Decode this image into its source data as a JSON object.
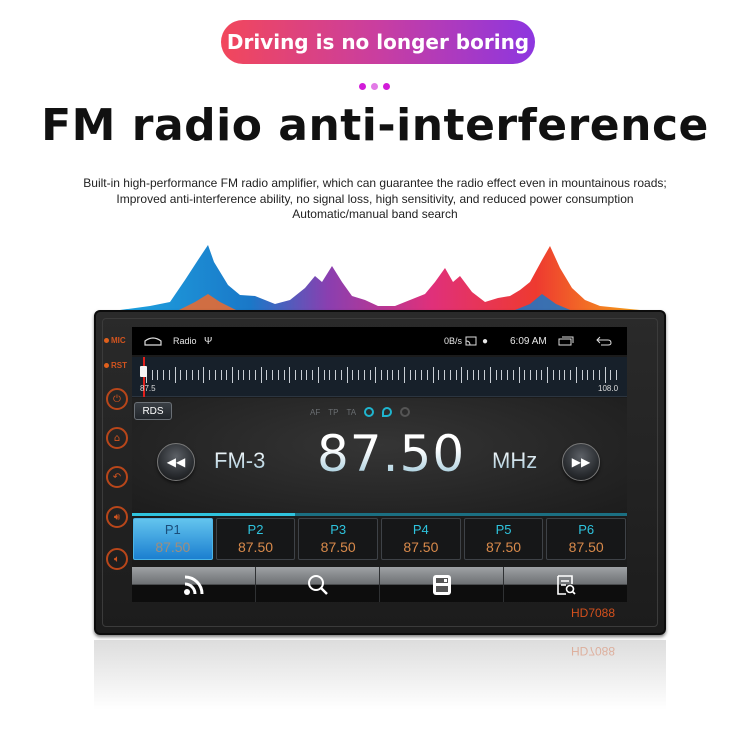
{
  "promo": {
    "banner": "Driving is no longer boring",
    "banner_colors": [
      "#f2475b",
      "#8d36e0"
    ],
    "dot_colors": [
      "#d21cd9",
      "#e27ae6",
      "#d21cd9"
    ],
    "headline": "FM radio anti-interference",
    "description": [
      "Built-in high-performance FM radio amplifier, which can guarantee the radio effect even in mountainous roads;",
      "Improved anti-interference ability, no signal loss, high sensitivity, and reduced power consumption",
      "Automatic/manual band search"
    ]
  },
  "device": {
    "model": "HD7088",
    "side_labels": {
      "mic": "MIC",
      "rst": "RST"
    },
    "side_buttons": [
      "power-icon",
      "home-icon",
      "back-icon",
      "volume-up-icon",
      "volume-down-icon"
    ],
    "accent": "#d4501d"
  },
  "status_bar": {
    "app_name": "Radio",
    "net_speed": "0B/s",
    "time": "6:09 AM"
  },
  "tuner": {
    "min_label": "87.5",
    "max_label": "108.0",
    "min": 87.5,
    "max": 108.0,
    "current": 87.5
  },
  "radio": {
    "rds_label": "RDS",
    "flags": [
      "AF",
      "TP",
      "TA"
    ],
    "band": "FM-3",
    "frequency": "87.50",
    "unit": "MHz",
    "preset_progress": 0.33,
    "presets": [
      {
        "name": "P1",
        "freq": "87.50",
        "active": true
      },
      {
        "name": "P2",
        "freq": "87.50",
        "active": false
      },
      {
        "name": "P3",
        "freq": "87.50",
        "active": false
      },
      {
        "name": "P4",
        "freq": "87.50",
        "active": false
      },
      {
        "name": "P5",
        "freq": "87.50",
        "active": false
      },
      {
        "name": "P6",
        "freq": "87.50",
        "active": false
      }
    ],
    "toolbar": [
      "broadcast-icon",
      "search-icon",
      "save-icon",
      "list-search-icon"
    ]
  }
}
